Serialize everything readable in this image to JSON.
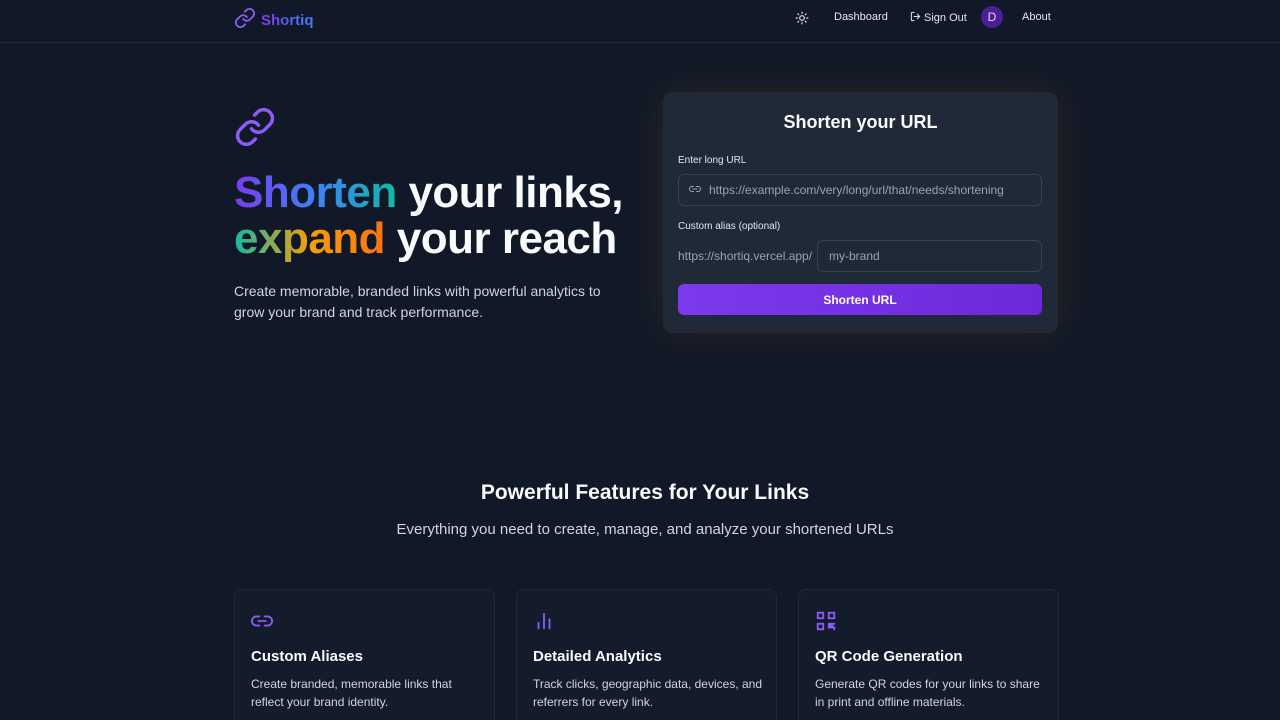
{
  "nav": {
    "brand": "Shortiq",
    "dashboard": "Dashboard",
    "sign_out": "Sign Out",
    "avatar_initial": "D",
    "about": "About"
  },
  "hero": {
    "title_part1": "Shorten",
    "title_part2": " your links,",
    "title_part3": "expand",
    "title_part4": " your reach",
    "subtitle": "Create memorable, branded links with powerful analytics to grow your brand and track performance."
  },
  "shorten_card": {
    "title": "Shorten your URL",
    "long_url_label": "Enter long URL",
    "long_url_placeholder": "https://example.com/very/long/url/that/needs/shortening",
    "alias_label": "Custom alias (optional)",
    "alias_prefix": "https://shortiq.vercel.app/",
    "alias_placeholder": "my-brand",
    "submit_label": "Shorten URL"
  },
  "features": {
    "title": "Powerful Features for Your Links",
    "subtitle": "Everything you need to create, manage, and analyze your shortened URLs",
    "items": [
      {
        "icon": "link-icon",
        "title": "Custom Aliases",
        "description": "Create branded, memorable links that reflect your brand identity."
      },
      {
        "icon": "bar-chart-icon",
        "title": "Detailed Analytics",
        "description": "Track clicks, geographic data, devices, and referrers for every link."
      },
      {
        "icon": "qr-code-icon",
        "title": "QR Code Generation",
        "description": "Generate QR codes for your links to share in print and offline materials."
      }
    ]
  },
  "colors": {
    "background": "#111827",
    "card": "#1f2937",
    "accent": "#7c3aed"
  }
}
